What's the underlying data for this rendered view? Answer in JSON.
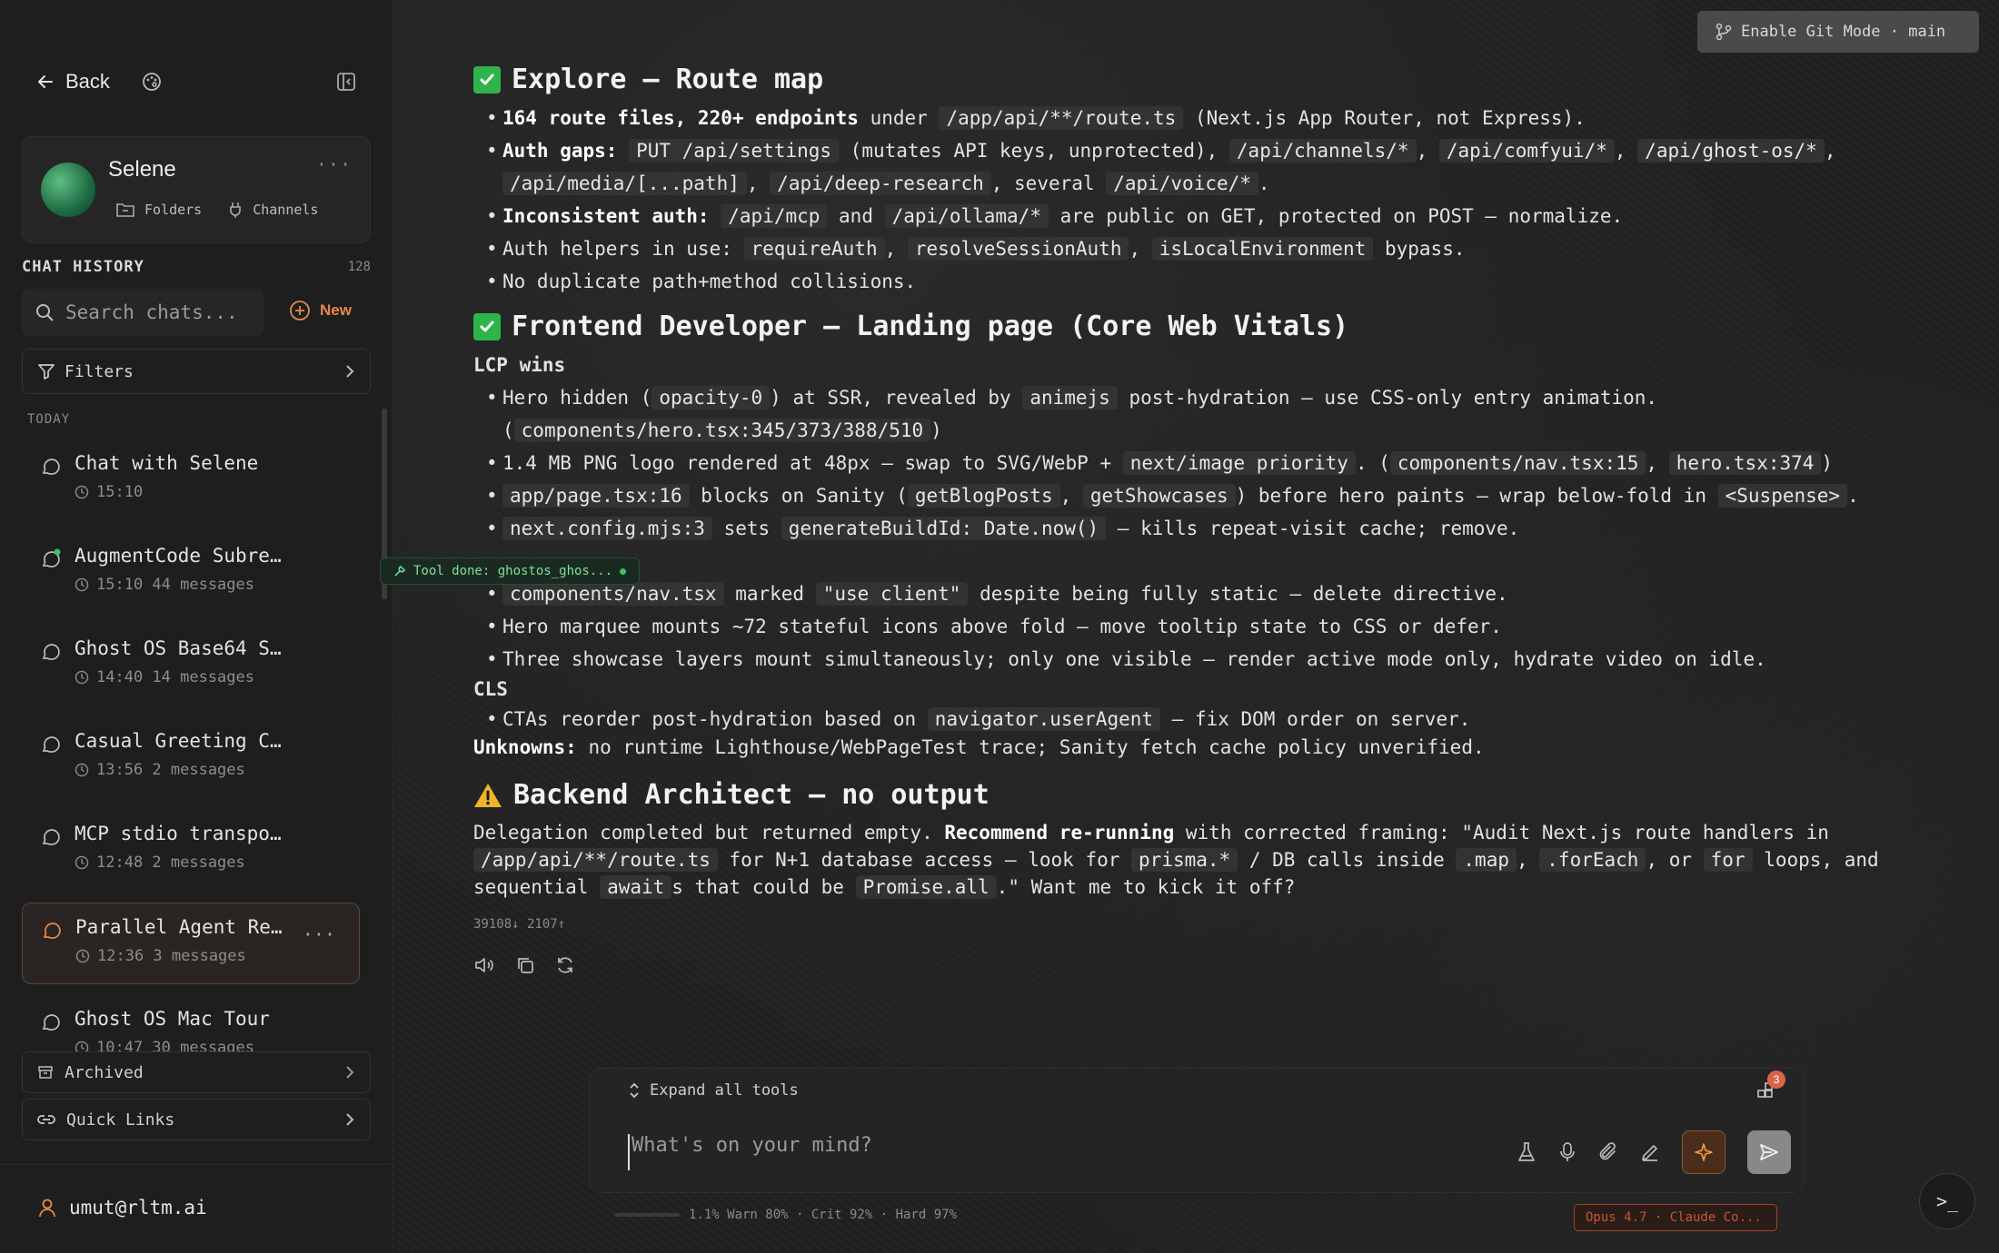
{
  "sidebar": {
    "back_label": "Back",
    "profile": {
      "name": "Selene",
      "folders_label": "Folders",
      "channels_label": "Channels"
    },
    "history": {
      "title": "CHAT HISTORY",
      "count": "128",
      "search_placeholder": "Search chats...",
      "new_label": "New",
      "filters_label": "Filters",
      "group_label": "TODAY"
    },
    "chats": [
      {
        "title": "Chat with Selene",
        "meta": "15:10"
      },
      {
        "title": "AugmentCode Subre...",
        "meta": "15:10 44 messages"
      },
      {
        "title": "Ghost OS Base64 S...",
        "meta": "14:40 14 messages"
      },
      {
        "title": "Casual Greeting C...",
        "meta": "13:56 2 messages"
      },
      {
        "title": "MCP stdio transpo...",
        "meta": "12:48 2 messages"
      },
      {
        "title": "Parallel Agent Re...",
        "meta": "12:36 3 messages"
      },
      {
        "title": "Ghost OS Mac Tour",
        "meta": "10:47 30 messages"
      }
    ],
    "tooltip": "Tool done: ghostos_ghos...",
    "archived_label": "Archived",
    "quicklinks_label": "Quick Links",
    "user_email": "umut@rltm.ai"
  },
  "header": {
    "git_button": "Enable Git Mode · main"
  },
  "message": {
    "s1": {
      "title": "Explore — Route map",
      "b1": {
        "bold": "164 route files, 220+ endpoints",
        "t1": " under ",
        "c1": "/app/api/**/route.ts",
        "t2": " (Next.js App Router, not Express)."
      },
      "b2": {
        "bold": "Auth gaps:",
        "c1": "PUT /api/settings",
        "t1": " (mutates API keys, unprotected), ",
        "c2": "/api/channels/*",
        "c3": "/api/comfyui/*",
        "c4": "/api/ghost-os/*",
        "c5": "/api/media/[...path]",
        "c6": "/api/deep-research",
        "t2": ", several ",
        "c7": "/api/voice/*"
      },
      "b3": {
        "bold": "Inconsistent auth:",
        "c1": "/api/mcp",
        "t1": " and ",
        "c2": "/api/ollama/*",
        "t2": " are public on GET, protected on POST — normalize."
      },
      "b4": {
        "t1": "Auth helpers in use: ",
        "c1": "requireAuth",
        "c2": "resolveSessionAuth",
        "c3": "isLocalEnvironment",
        "t2": " bypass."
      },
      "b5": {
        "t1": "No duplicate path+method collisions."
      }
    },
    "s2": {
      "title": "Frontend Developer — Landing page (Core Web Vitals)",
      "lcp_label": "LCP wins",
      "b1": {
        "t1": "Hero hidden (",
        "c1": "opacity-0",
        "t2": ") at SSR, revealed by ",
        "c2": "animejs",
        "t3": " post-hydration — use CSS-only entry animation.",
        "t4": "(",
        "c3": "components/hero.tsx:345/373/388/510",
        "t5": ")"
      },
      "b2": {
        "t1": "1.4 MB PNG logo rendered at 48px — swap to SVG/WebP + ",
        "c1": "next/image priority",
        "t2": ". (",
        "c2": "components/nav.tsx:15",
        "c3": "hero.tsx:374",
        "t3": ")"
      },
      "b3": {
        "c1": "app/page.tsx:16",
        "t1": " blocks on Sanity (",
        "c2": "getBlogPosts",
        "c3": "getShowcases",
        "t2": ") before hero paints — wrap below-fold in ",
        "c4": "<Suspense>"
      },
      "b4": {
        "c1": "next.config.mjs:3",
        "t1": " sets ",
        "c2": "generateBuildId: Date.now()",
        "t2": " — kills repeat-visit cache; remove."
      },
      "b5": {
        "c1": "components/nav.tsx",
        "t1": " marked ",
        "c2": "\"use client\"",
        "t2": " despite being fully static — delete directive."
      },
      "b6": {
        "t1": "Hero marquee mounts ~72 stateful icons above fold — move tooltip state to CSS or defer."
      },
      "b7": {
        "t1": "Three showcase layers mount simultaneously; only one visible — render active mode only, hydrate video on idle."
      },
      "cls_label": "CLS",
      "b8": {
        "t1": "CTAs reorder post-hydration based on ",
        "c1": "navigator.userAgent",
        "t2": " — fix DOM order on server."
      },
      "unknowns_label": "Unknowns:",
      "unknowns_text": " no runtime Lighthouse/WebPageTest trace; Sanity fetch cache policy unverified."
    },
    "s3": {
      "title": "Backend Architect — no output",
      "p": {
        "t1": "Delegation completed but returned empty. ",
        "bold": "Recommend re-running",
        "t2": " with corrected framing: \"Audit Next.js route handlers in ",
        "c1": "/app/api/**/route.ts",
        "t3": " for N+1 database access — look for ",
        "c2": "prisma.*",
        "t4": " / DB calls inside ",
        "c3": ".map",
        "c4": ".forEach",
        "t5": ", or ",
        "c5": "for",
        "t6": " loops, and sequential ",
        "c6": "await",
        "t7": "s that could be ",
        "c7": "Promise.all",
        "t8": ".\" Want me to kick it off?"
      }
    },
    "tokens": "39108↓ 2107↑"
  },
  "composer": {
    "expand_label": "Expand all tools",
    "badge": "3",
    "placeholder": "What's on your mind?",
    "status": "1.1% Warn 80% · Crit 92% · Hard 97%",
    "model": "Opus 4.7 · Claude Co..."
  },
  "colors": {
    "accent": "#e6894a",
    "success": "#2fb44a",
    "warning": "#f0b429",
    "model_border": "#a0432a"
  }
}
